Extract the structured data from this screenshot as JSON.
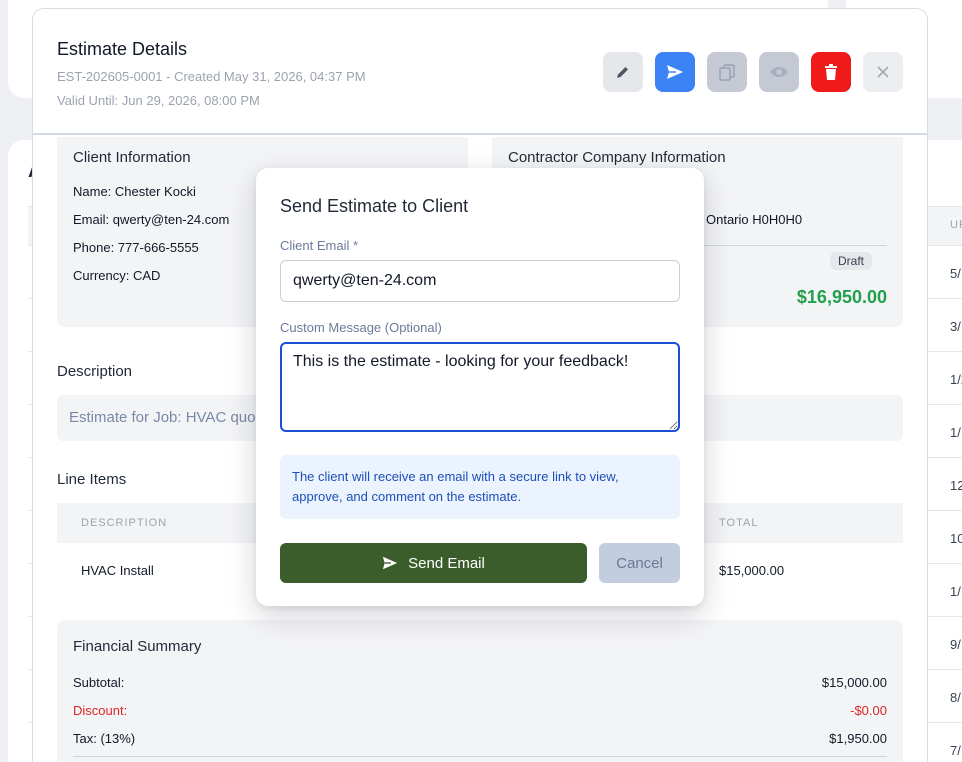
{
  "background": {
    "heading_fragment": "A",
    "column_header_fragment": "UP",
    "row_fragments": [
      "5/",
      "3/",
      "1/2",
      "1/1",
      "12",
      "10",
      "1/1",
      "9/",
      "8/",
      "7/"
    ]
  },
  "estimate": {
    "title": "Estimate Details",
    "meta_line": "EST-202605-0001 - Created May 31, 2026, 04:37 PM",
    "valid_until": "Valid Until: Jun 29, 2026, 08:00 PM",
    "actions": {
      "edit_icon": "pencil-icon",
      "send_icon": "send-icon",
      "copy_icon": "copy-icon",
      "view_icon": "eye-icon",
      "delete_icon": "trash-icon",
      "close_icon": "close-icon"
    },
    "client": {
      "title": "Client Information",
      "name_label": "Name:",
      "name": "Chester Kocki",
      "email_label": "Email:",
      "email": "qwerty@ten-24.com",
      "phone_label": "Phone:",
      "phone": "777-666-5555",
      "currency_label": "Currency:",
      "currency": "CAD"
    },
    "contractor": {
      "title": "Contractor Company Information",
      "address_fragment": "Ontario H0H0H0",
      "status_badge": "Draft",
      "total": "$16,950.00"
    },
    "description": {
      "label": "Description",
      "text": "Estimate for Job: HVAC quo"
    },
    "line_items": {
      "label": "Line Items",
      "columns": {
        "description": "DESCRIPTION",
        "total": "TOTAL"
      },
      "rows": [
        {
          "description": "HVAC Install",
          "total": "$15,000.00"
        }
      ]
    },
    "financial": {
      "title": "Financial Summary",
      "subtotal_label": "Subtotal:",
      "subtotal": "$15,000.00",
      "discount_label": "Discount:",
      "discount": "-$0.00",
      "tax_label": "Tax:  (13%)",
      "tax": "$1,950.00"
    }
  },
  "send_dialog": {
    "title": "Send Estimate to Client",
    "email_label": "Client Email *",
    "email_value": "qwerty@ten-24.com",
    "message_label": "Custom Message (Optional)",
    "message_value": "This is the estimate - looking for your feedback!",
    "info_note": "The client will receive an email with a secure link to view, approve, and comment on the estimate.",
    "send_label": "Send Email",
    "cancel_label": "Cancel"
  },
  "colors": {
    "send_button": "#3b5d2b",
    "primary_blue": "#3b82f6",
    "danger_red": "#ef1b1b",
    "total_green": "#22a04b",
    "discount_red": "#dc2626"
  }
}
